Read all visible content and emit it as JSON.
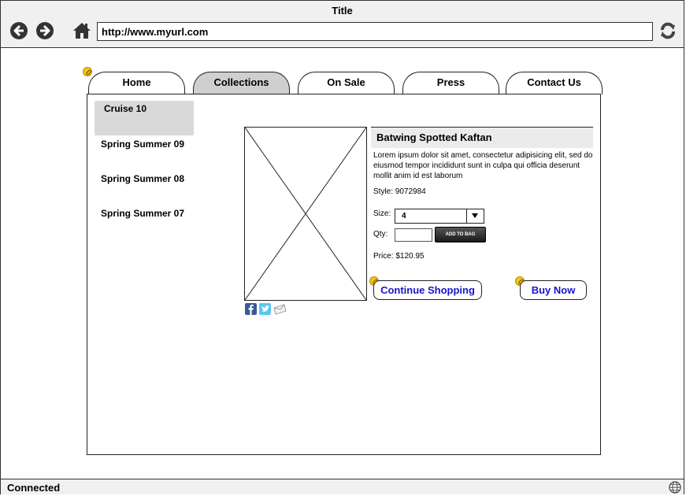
{
  "window": {
    "title": "Title"
  },
  "toolbar": {
    "url": "http://www.myurl.com"
  },
  "tabs": [
    {
      "label": "Home"
    },
    {
      "label": "Collections",
      "active": true
    },
    {
      "label": "On Sale"
    },
    {
      "label": "Press"
    },
    {
      "label": "Contact Us"
    }
  ],
  "sidebar": {
    "items": [
      {
        "label": "Cruise 10",
        "active": true
      },
      {
        "label": "Spring Summer 09"
      },
      {
        "label": "Spring Summer 08"
      },
      {
        "label": "Spring Summer 07"
      }
    ]
  },
  "product": {
    "title": "Batwing Spotted Kaftan",
    "description": "Lorem ipsum dolor sit amet, consectetur adipisicing elit, sed do eiusmod tempor incididunt sunt in culpa qui officia deserunt mollit anim id est laborum",
    "style": "Style: 9072984",
    "size_label": "Size:",
    "size_value": "4",
    "qty_label": "Qty:",
    "qty_value": "",
    "add_to_bag": "ADD TO BAG",
    "price": "Price: $120.95"
  },
  "actions": {
    "continue_shopping": "Continue Shopping",
    "buy_now": "Buy Now"
  },
  "status": {
    "text": "Connected"
  },
  "icons": {
    "back": "back-arrow-icon",
    "forward": "forward-arrow-icon",
    "home": "home-icon",
    "refresh": "refresh-icon",
    "globe": "globe-icon",
    "facebook": "facebook-icon",
    "twitter": "twitter-icon",
    "email": "email-icon",
    "link": "link-icon"
  },
  "colors": {
    "link_text": "#1515c8",
    "active_tab": "#cfcfcf",
    "active_sidebar": "#d9d9d9",
    "badge": "#f2c614"
  }
}
